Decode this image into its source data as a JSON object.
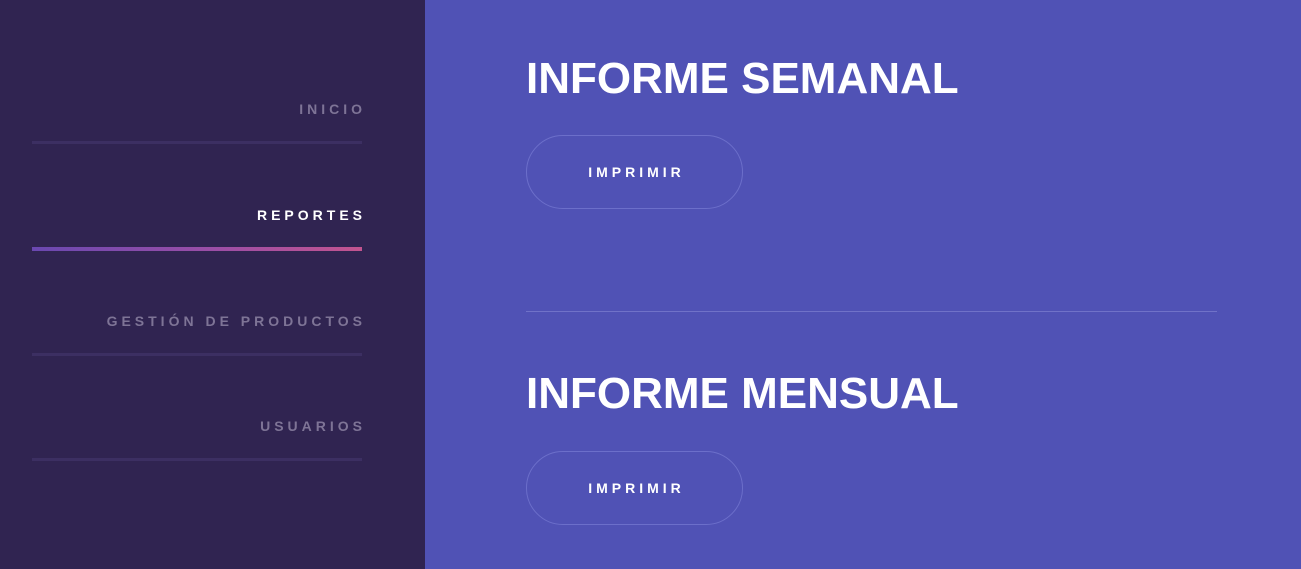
{
  "sidebar": {
    "items": [
      {
        "label": "INICIO",
        "active": false
      },
      {
        "label": "REPORTES",
        "active": true
      },
      {
        "label": "GESTIÓN DE PRODUCTOS",
        "active": false
      },
      {
        "label": "USUARIOS",
        "active": false
      }
    ]
  },
  "main": {
    "reports": [
      {
        "title": "INFORME SEMANAL",
        "button_label": "IMPRIMIR"
      },
      {
        "title": "INFORME MENSUAL",
        "button_label": "IMPRIMIR"
      }
    ]
  },
  "colors": {
    "sidebar_bg": "#302451",
    "main_bg": "#5052b5",
    "active_underline_start": "#6a48b0",
    "active_underline_end": "#c2548f",
    "inactive_text": "#7e7496",
    "active_text": "#ffffff"
  }
}
